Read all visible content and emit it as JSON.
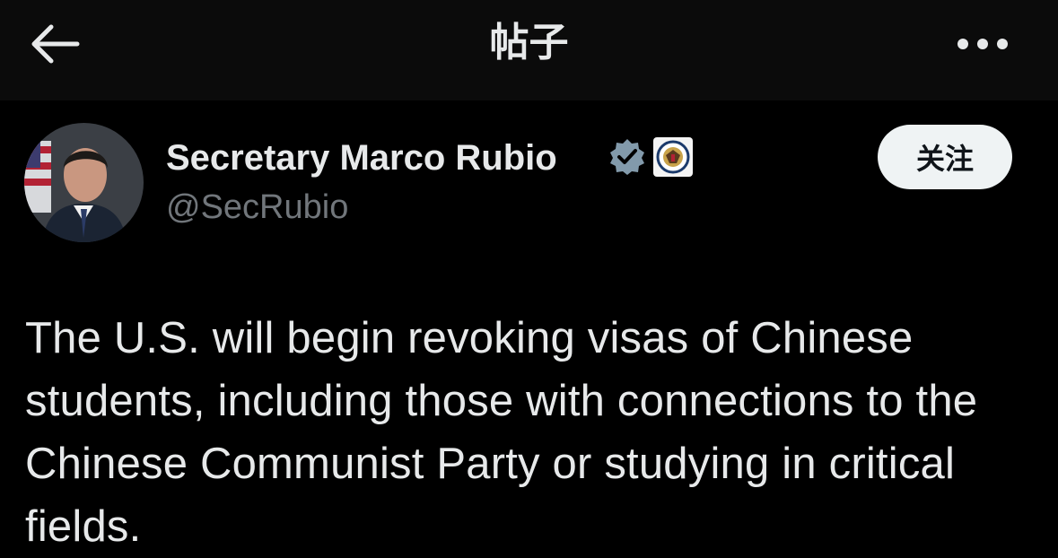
{
  "header": {
    "title": "帖子",
    "back_icon": "arrow-left-icon",
    "more_icon": "more-horizontal-icon"
  },
  "author": {
    "name": "Secretary Marco Rubio",
    "handle": "@SecRubio",
    "verified_icon": "verified-badge-icon",
    "affiliation_icon": "state-department-seal-icon",
    "follow_label": "关注"
  },
  "post": {
    "text": "The U.S. will begin revoking visas of Chinese students, including those with connections to the Chinese Communist Party or studying in critical fields."
  },
  "colors": {
    "background": "#000000",
    "header_background": "#0b0b0b",
    "primary_text": "#e7e9ea",
    "secondary_text": "#71767b",
    "follow_button": "#eff3f4",
    "verified_badge": "#829aab"
  }
}
